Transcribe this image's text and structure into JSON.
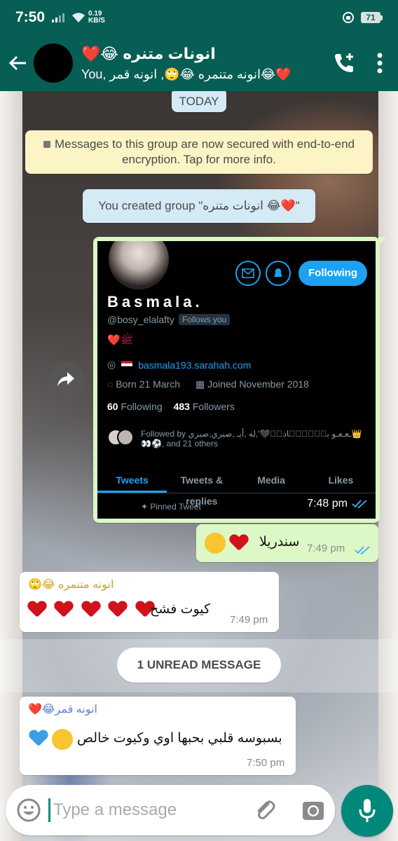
{
  "status_bar": {
    "time": "7:50",
    "net_speed_value": "0.19",
    "net_speed_unit": "KB/S",
    "battery": "71"
  },
  "header": {
    "title": "انونات متنره 😂❤️",
    "subtitle": "You, انونه متنمره 😂🙄, انونه قمر😂❤️"
  },
  "chat": {
    "date_chip": "TODAY",
    "encryption_notice": "Messages to this group are now secured with end-to-end encryption. Tap for more info.",
    "created_notice": "You created group \"انونات متنره 😂❤️\"",
    "unread_label": "1 UNREAD MESSAGE",
    "messages": [
      {
        "type": "image",
        "direction": "outgoing",
        "time": "7:48 pm",
        "status": "read",
        "twitter_profile": {
          "name": "Basmala.",
          "handle": "@bosy_elalafty",
          "follows_you": "Follows you",
          "bio": "❤️ﷺ",
          "link": "basmala193.sarahah.com",
          "born": "Born 21 March",
          "joined": "Joined November 2018",
          "following_count": "60",
          "following_label": "Following",
          "followers_count": "483",
          "followers_label": "Followers",
          "follow_button": "Following",
          "followed_by": "Followed by ـعـعـو بـۣۣنۣۣاديۣ🖤',له ,أيـ ,صبري,صبري👑",
          "followed_by_more": "👀⚽, and 21 others",
          "tabs": [
            "Tweets",
            "Tweets & replies",
            "Media",
            "Likes"
          ],
          "pinned": "Pinned Tweet"
        }
      },
      {
        "type": "text",
        "direction": "outgoing",
        "text": "سندريلا",
        "time": "7:49 pm",
        "status": "read"
      },
      {
        "type": "text",
        "direction": "incoming",
        "sender": "انونه متنمره 😂🙄",
        "sender_color": "#c9a227",
        "text": "كيوت فشخ",
        "time": "7:49 pm"
      },
      {
        "type": "text",
        "direction": "incoming",
        "sender": "انونه قمر😂❤️",
        "sender_color": "#5f7fd6",
        "text": "بسبوسه قلبي بحبها اوي وكيوت خالص",
        "time": "7:50 pm"
      }
    ]
  },
  "composer": {
    "placeholder": "Type a message"
  },
  "colors": {
    "header": "#075e54",
    "outgoing": "#dcf8c6",
    "incoming": "#ffffff",
    "accent": "#00897b",
    "twitter_blue": "#1da1f2"
  }
}
